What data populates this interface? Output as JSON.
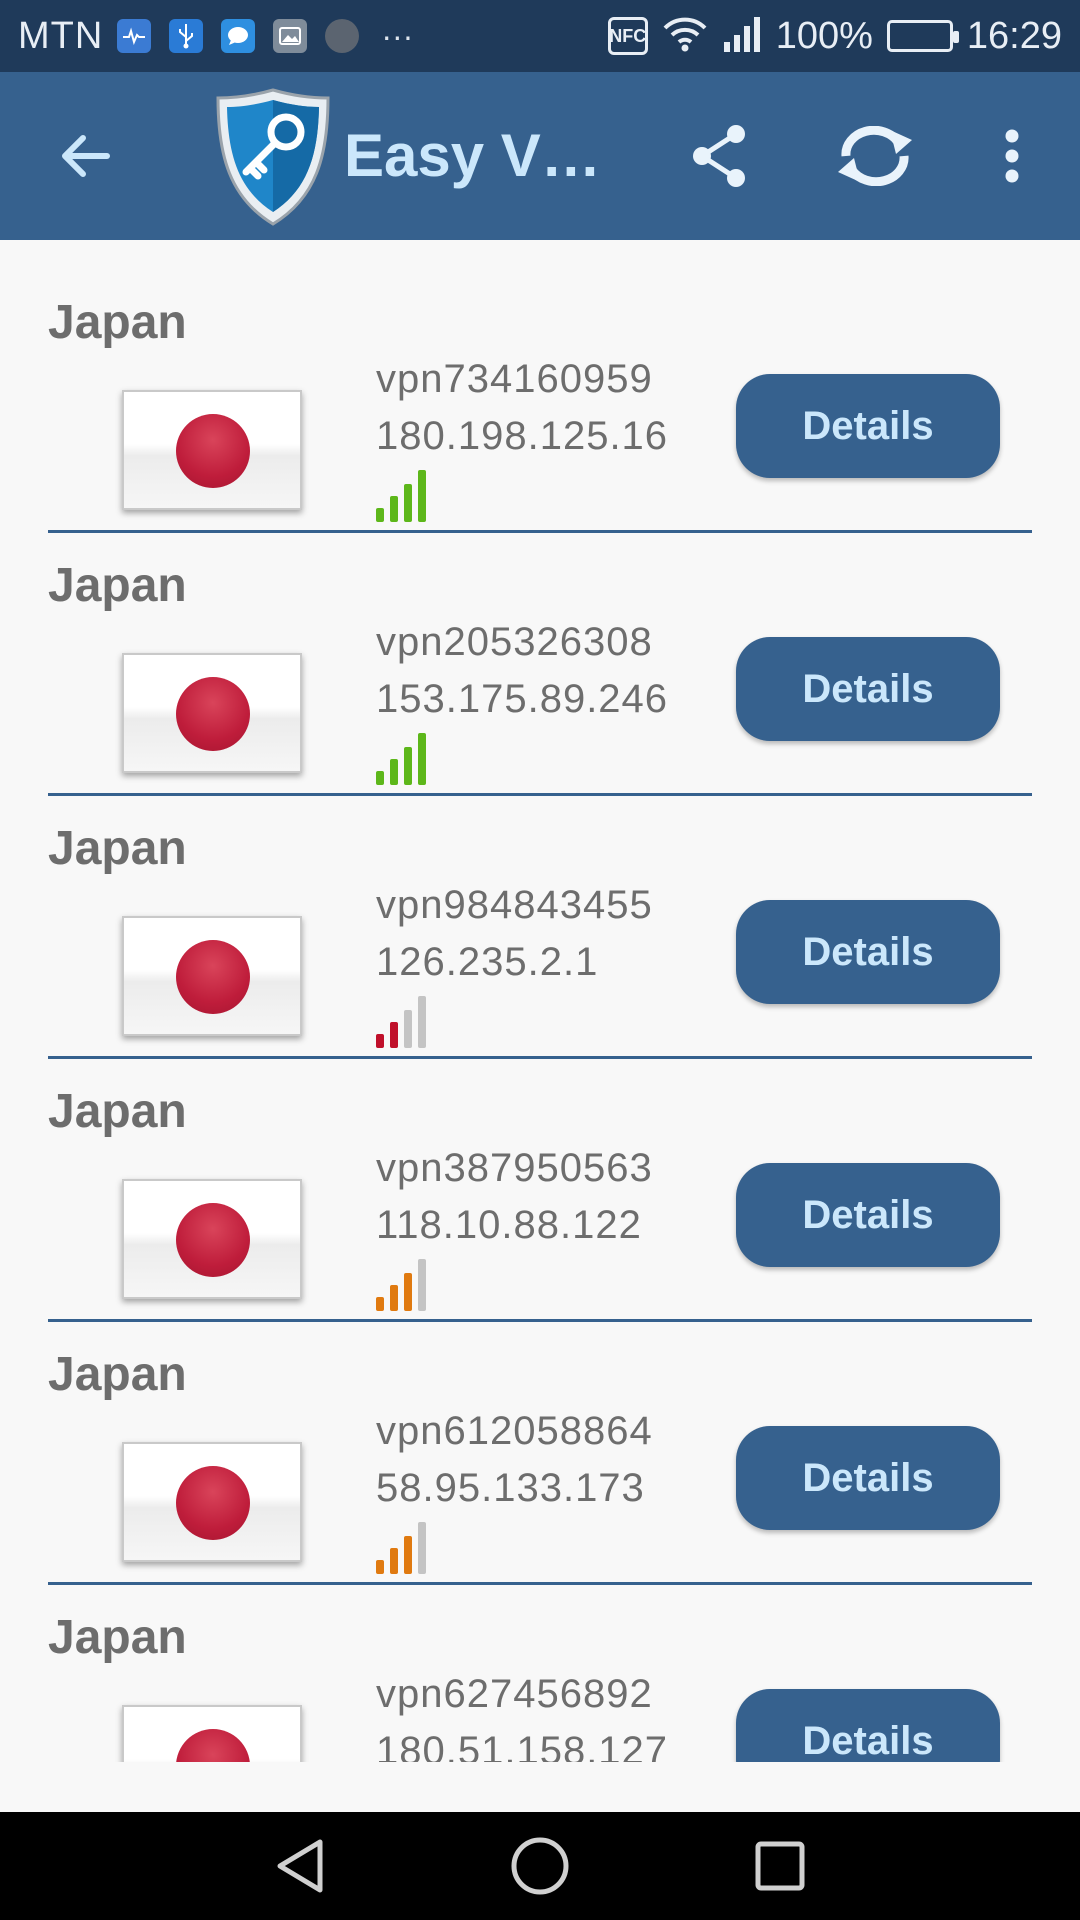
{
  "status_bar": {
    "carrier": "MTN",
    "nfc": "NFC",
    "battery_percent": "100%",
    "time": "16:29",
    "overflow": "···"
  },
  "app_bar": {
    "title": "Easy V…",
    "icons": [
      "arrow-back-icon",
      "shield-key-logo",
      "share-icon",
      "refresh-icon",
      "more-vert-icon"
    ]
  },
  "servers": [
    {
      "country": "Japan",
      "host": "vpn734160959",
      "ip": "180.198.125.16",
      "signal_bars": 4,
      "signal_color": "#5db71a",
      "details_label": "Details"
    },
    {
      "country": "Japan",
      "host": "vpn205326308",
      "ip": "153.175.89.246",
      "signal_bars": 4,
      "signal_color": "#5db71a",
      "details_label": "Details"
    },
    {
      "country": "Japan",
      "host": "vpn984843455",
      "ip": "126.235.2.1",
      "signal_bars": 2,
      "signal_color": "#c0102a",
      "details_label": "Details"
    },
    {
      "country": "Japan",
      "host": "vpn387950563",
      "ip": "118.10.88.122",
      "signal_bars": 3,
      "signal_color": "#e07a10",
      "details_label": "Details"
    },
    {
      "country": "Japan",
      "host": "vpn612058864",
      "ip": "58.95.133.173",
      "signal_bars": 3,
      "signal_color": "#e07a10",
      "details_label": "Details"
    },
    {
      "country": "Japan",
      "host": "vpn627456892",
      "ip": "180.51.158.127",
      "signal_bars": 4,
      "signal_color": "#5db71a",
      "details_label": "Details"
    }
  ],
  "colors": {
    "status_bar": "#1f3a5a",
    "app_bar": "#36618e",
    "accent_text": "#cbe7fb",
    "list_bg": "#f8f8f8",
    "divider": "#36618e",
    "signal_inactive": "#c4c4c4"
  },
  "nav_bar": {
    "icons": [
      "nav-back-icon",
      "nav-home-icon",
      "nav-recents-icon"
    ]
  }
}
